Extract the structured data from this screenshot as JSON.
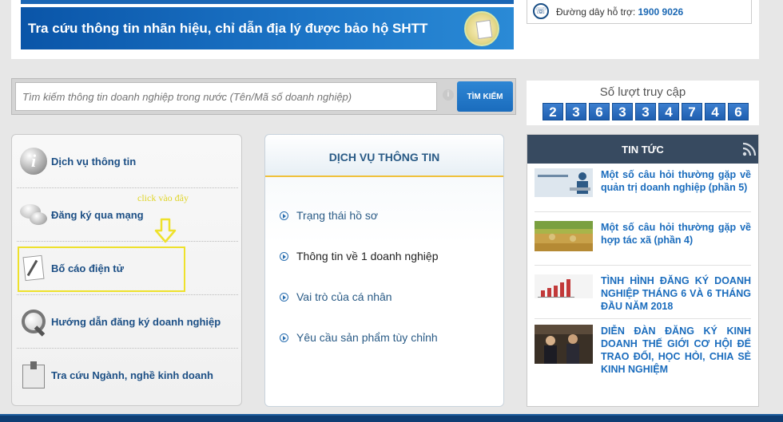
{
  "banner": {
    "text": "Tra cứu thông tin nhãn hiệu, chỉ dẫn địa lý được bảo hộ SHTT"
  },
  "support": {
    "label": "Đường dây hỗ trợ:",
    "phone": "1900 9026"
  },
  "search": {
    "placeholder": "Tìm kiếm thông tin doanh nghiệp trong nước (Tên/Mã số doanh nghiệp)",
    "button_label": "TÌM KIẾM",
    "info_glyph": "i"
  },
  "counter": {
    "title": "Số lượt truy cập",
    "digits": [
      "2",
      "3",
      "6",
      "3",
      "3",
      "4",
      "7",
      "4",
      "6"
    ]
  },
  "left_menu": {
    "items": [
      {
        "label": "Dịch vụ thông tin",
        "icon": "info-icon"
      },
      {
        "label": "Đăng ký qua mạng",
        "icon": "chat-icon"
      },
      {
        "label": "Bố cáo điện tử",
        "icon": "document-pen-icon"
      },
      {
        "label": "Hướng dẫn đăng ký doanh nghiệp",
        "icon": "magnifier-icon"
      },
      {
        "label": "Tra cứu Ngành, nghề kinh doanh",
        "icon": "book-icon"
      }
    ]
  },
  "annotation": {
    "text": "click vào đây",
    "color": "#eee12b"
  },
  "services": {
    "title": "DỊCH VỤ THÔNG TIN",
    "items": [
      {
        "label": "Trạng thái hồ sơ"
      },
      {
        "label": "Thông tin về 1 doanh nghiệp"
      },
      {
        "label": "Vai trò của cá nhân"
      },
      {
        "label": "Yêu cầu sản phẩm tùy chỉnh"
      }
    ]
  },
  "news": {
    "title": "TIN TỨC",
    "items": [
      {
        "title": "Một số câu hỏi thường gặp về quản trị doanh nghiệp (phần 5)",
        "thumb": "qa-thumbnail"
      },
      {
        "title": "Một số câu hỏi thường gặp về hợp tác xã (phần 4)",
        "thumb": "rice-field-thumbnail"
      },
      {
        "title": "TÌNH HÌNH ĐĂNG KÝ DOANH NGHIỆP THÁNG 6 VÀ 6 THÁNG ĐẦU NĂM 2018",
        "thumb": "bar-chart-thumbnail"
      },
      {
        "title": "DIỄN ĐÀN ĐĂNG KÝ KINH DOANH THẾ GIỚI CƠ HỘI ĐỂ TRAO ĐỔI, HỌC HỎI, CHIA SẺ KINH NGHIỆM",
        "thumb": "forum-photo-thumbnail"
      }
    ]
  },
  "colors": {
    "brand_blue": "#1a6cbd",
    "header_dark": "#374a60",
    "highlight": "#eee12b",
    "accent_gold": "#f0c13b"
  }
}
